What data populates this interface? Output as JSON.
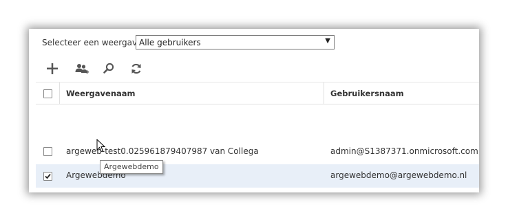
{
  "view_selector": {
    "label": "Selecteer een weergave:",
    "value": "Alle gebruikers"
  },
  "toolbar": {
    "icons": [
      "plus-icon",
      "users-add-icon",
      "search-icon",
      "refresh-icon"
    ]
  },
  "table": {
    "columns": [
      "Weergavenaam",
      "Gebruikersnaam"
    ],
    "rows": [
      {
        "display_name": "argeweb-test0.025961879407987 van Collega",
        "username": "admin@S1387371.onmicrosoft.com",
        "checked": false
      },
      {
        "display_name": "Argewebdemo",
        "username": "argewebdemo@argewebdemo.nl",
        "checked": true
      }
    ]
  },
  "tooltip": {
    "text": "Argewebdemo"
  },
  "colors": {
    "selected_row": "#e8eff8",
    "icon": "#555555"
  }
}
